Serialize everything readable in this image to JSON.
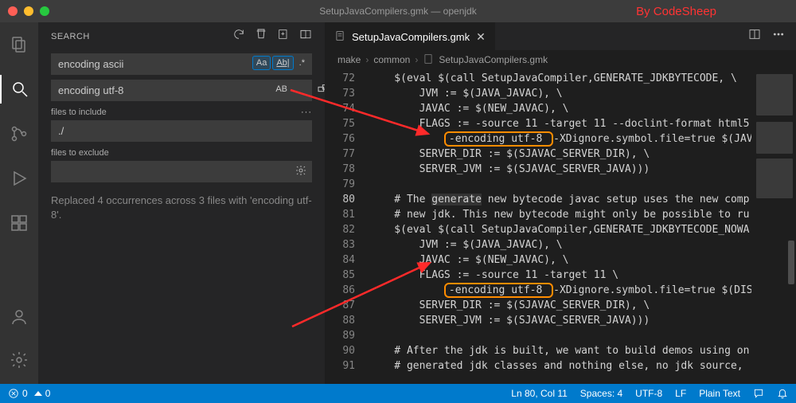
{
  "window": {
    "title": "SetupJavaCompilers.gmk — openjdk"
  },
  "watermark": "By CodeSheep",
  "search": {
    "title": "SEARCH",
    "find_value": "encoding ascii",
    "replace_value": "encoding utf-8",
    "opt_case": "Aa",
    "opt_word": "Ab|",
    "opt_regex": ".*",
    "opt_preserve": "AB",
    "include_label": "files to include",
    "include_value": "./",
    "exclude_label": "files to exclude",
    "exclude_value": "",
    "result_msg": "Replaced 4 occurrences across 3 files with 'encoding utf-8'."
  },
  "tabs": {
    "active": {
      "name": "SetupJavaCompilers.gmk"
    }
  },
  "breadcrumb": {
    "seg1": "make",
    "seg2": "common",
    "seg3": "SetupJavaCompilers.gmk"
  },
  "lines": [
    {
      "n": 72,
      "t": "    $(eval $(call SetupJavaCompiler,GENERATE_JDKBYTECODE, \\"
    },
    {
      "n": 73,
      "t": "        JVM := $(JAVA_JAVAC), \\"
    },
    {
      "n": 74,
      "t": "        JAVAC := $(NEW_JAVAC), \\"
    },
    {
      "n": 75,
      "t": "        FLAGS := -source 11 -target 11 --doclint-format html5"
    },
    {
      "n": 76,
      "t": "            ",
      "hl": "-encoding utf-8 ",
      "t2": "-XDignore.symbol.file=true $(JAVA"
    },
    {
      "n": 77,
      "t": "        SERVER_DIR := $(SJAVAC_SERVER_DIR), \\"
    },
    {
      "n": 78,
      "t": "        SERVER_JVM := $(SJAVAC_SERVER_JAVA)))"
    },
    {
      "n": 79,
      "t": ""
    },
    {
      "n": 80,
      "t": "    # The ",
      "gen": "generate",
      "t2": " new bytecode javac setup uses the new comp"
    },
    {
      "n": 81,
      "t": "    # new jdk. This new bytecode might only be possible to ru"
    },
    {
      "n": 82,
      "t": "    $(eval $(call SetupJavaCompiler,GENERATE_JDKBYTECODE_NOWA"
    },
    {
      "n": 83,
      "t": "        JVM := $(JAVA_JAVAC), \\"
    },
    {
      "n": 84,
      "t": "        JAVAC := $(NEW_JAVAC), \\"
    },
    {
      "n": 85,
      "t": "        FLAGS := -source 11 -target 11 \\"
    },
    {
      "n": 86,
      "t": "            ",
      "hl": "-encoding utf-8 ",
      "t2": "-XDignore.symbol.file=true $(DISA"
    },
    {
      "n": 87,
      "t": "        SERVER_DIR := $(SJAVAC_SERVER_DIR), \\"
    },
    {
      "n": 88,
      "t": "        SERVER_JVM := $(SJAVAC_SERVER_JAVA)))"
    },
    {
      "n": 89,
      "t": ""
    },
    {
      "n": 90,
      "t": "    # After the jdk is built, we want to build demos using on"
    },
    {
      "n": 91,
      "t": "    # generated jdk classes and nothing else, no jdk source,"
    }
  ],
  "status": {
    "errors": "0",
    "warnings": "0",
    "cursor": "Ln 80, Col 11",
    "spaces": "Spaces: 4",
    "encoding": "UTF-8",
    "eol": "LF",
    "lang": "Plain Text"
  }
}
